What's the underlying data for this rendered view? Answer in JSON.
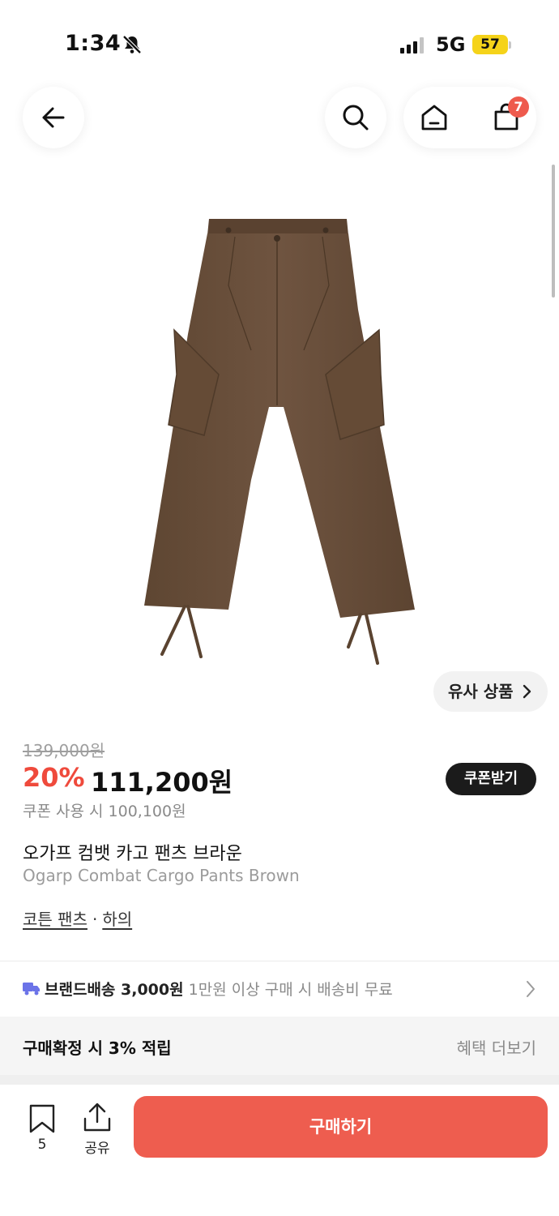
{
  "status_bar": {
    "time": "1:34",
    "network": "5G",
    "battery": "57"
  },
  "top_nav": {
    "back_icon": "arrow-left-icon",
    "search_icon": "search-icon",
    "home_icon": "home-icon",
    "cart_icon": "shopping-bag-icon",
    "cart_count": "7"
  },
  "product": {
    "image": "brown-cargo-pants",
    "similar_label": "유사 상품",
    "original_price": "139,000원",
    "discount_rate": "20%",
    "sale_price": "111,200원",
    "coupon_button": "쿠폰받기",
    "coupon_price": "쿠폰 사용 시 100,100원",
    "name": "오가프 컴뱃 카고 팬츠 브라운",
    "name_en": "Ogarp Combat Cargo Pants Brown",
    "category": "코튼 팬츠",
    "separator": "·",
    "parent_category": "하의"
  },
  "shipping": {
    "icon": "truck-icon",
    "label": "브랜드배송 3,000원",
    "note": "1만원 이상 구매 시 배송비 무료"
  },
  "benefit": {
    "title": "구매확정 시 3% 적립",
    "more": "혜택 더보기"
  },
  "bottom_bar": {
    "bookmark_count": "5",
    "share_label": "공유",
    "buy_label": "구매하기"
  },
  "colors": {
    "accent": "#ee5d4f",
    "discount": "#ef4a3c",
    "badge": "#ee5a4d",
    "battery": "#f5d31a",
    "product_brown": "#6b5038"
  }
}
